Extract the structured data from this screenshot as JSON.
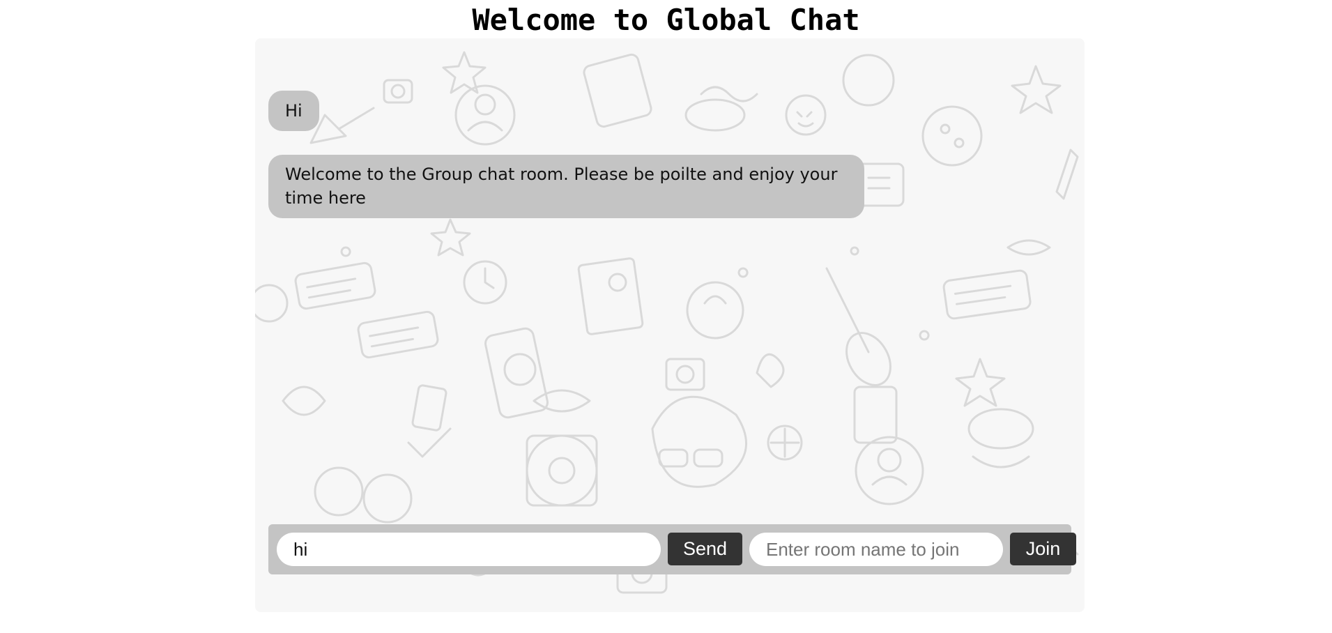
{
  "page": {
    "title": "Welcome to Global Chat"
  },
  "chat": {
    "messages": [
      {
        "text": "Hi"
      },
      {
        "text": "Welcome to the Group chat room. Please be poilte and enjoy your time here"
      }
    ],
    "background_icons": [
      "doodle-pattern"
    ]
  },
  "composer": {
    "message_value": "hi",
    "send_label": "Send",
    "room_placeholder": "Enter room name to join",
    "room_value": "",
    "join_label": "Join"
  },
  "colors": {
    "bubble": "#c4c4c4",
    "button": "#333333",
    "chat_background": "#f7f7f7"
  }
}
